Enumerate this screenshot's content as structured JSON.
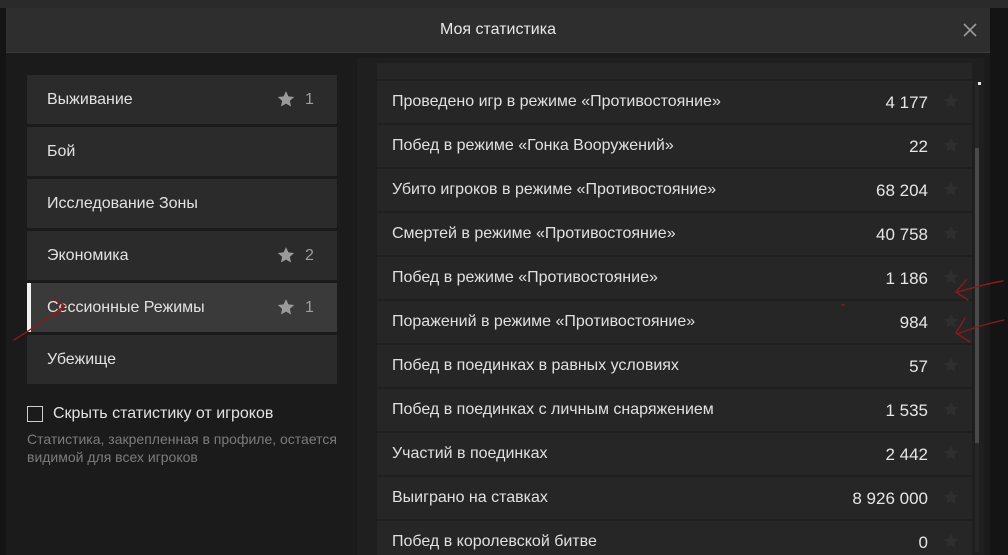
{
  "dialog": {
    "title": "Моя статистика"
  },
  "categories": [
    {
      "label": "Выживание",
      "count": "1",
      "starred": true
    },
    {
      "label": "Бой",
      "count": "",
      "starred": false
    },
    {
      "label": "Исследование Зоны",
      "count": "",
      "starred": false
    },
    {
      "label": "Экономика",
      "count": "2",
      "starred": true
    },
    {
      "label": "Сессионные Режимы",
      "count": "1",
      "starred": true,
      "active": true
    },
    {
      "label": "Убежище",
      "count": "",
      "starred": false
    }
  ],
  "privacy": {
    "label": "Скрыть статистику от игроков",
    "checked": false,
    "hint": "Статистика, закрепленная в профиле, остается видимой для всех игроков"
  },
  "stats": [
    {
      "label": "Проведено игр в режиме «Противостояние»",
      "value": "4 177"
    },
    {
      "label": "Побед в режиме «Гонка Вооружений»",
      "value": "22"
    },
    {
      "label": "Убито игроков в режиме «Противостояние»",
      "value": "68 204"
    },
    {
      "label": "Смертей в режиме «Противостояние»",
      "value": "40 758"
    },
    {
      "label": "Побед в режиме «Противостояние»",
      "value": "1 186"
    },
    {
      "label": "Поражений в режиме «Противостояние»",
      "value": "984"
    },
    {
      "label": "Побед в поединках в равных условиях",
      "value": "57"
    },
    {
      "label": "Побед в поединках с личным снаряжением",
      "value": "1 535"
    },
    {
      "label": "Участий в поединках",
      "value": "2 442"
    },
    {
      "label": "Выиграно на ставках",
      "value": "8 926 000"
    },
    {
      "label": "Побед в королевской битве",
      "value": "0"
    }
  ],
  "icons": {
    "star": "star-icon",
    "close": "close-icon",
    "checkbox": "checkbox-icon"
  },
  "colors": {
    "background": "#1b1b1b",
    "annotation": "#8c1a1a",
    "active_marker": "#f2f2f2"
  }
}
